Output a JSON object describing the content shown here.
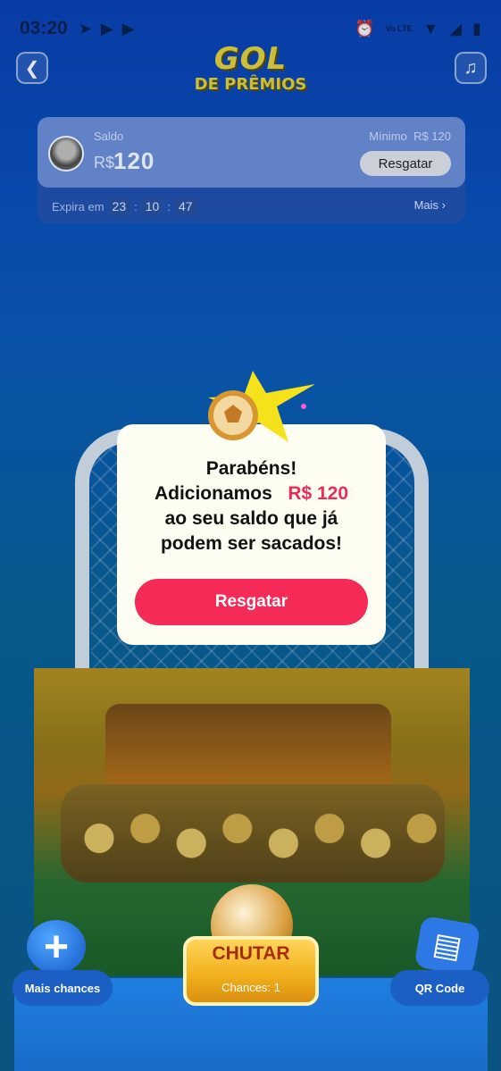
{
  "status_bar": {
    "time": "03:20",
    "notification_icons": [
      "telegram-icon",
      "youtube-icon",
      "youtube-icon"
    ],
    "right_icons": [
      "alarm-icon",
      "volte-icon",
      "wifi-icon",
      "signal-icon",
      "battery-icon"
    ],
    "volte_text": "Vo LTE"
  },
  "header": {
    "logo_line1": "GOL",
    "logo_line2": "DE PRÊMIOS"
  },
  "balance": {
    "label": "Saldo",
    "currency": "R$",
    "amount": "120",
    "minimum_label": "Mínimo",
    "minimum_value": "R$ 120",
    "redeem_label": "Resgatar",
    "expires_label": "Expira em",
    "hours": "23",
    "minutes": "10",
    "seconds": "47",
    "separator": ":",
    "more_label": "Mais",
    "more_chevron": "›"
  },
  "modal": {
    "line1": "Parabéns!",
    "line2_prefix": "Adicionamos",
    "amount": "R$ 120",
    "line3": "ao seu saldo que já",
    "line4": "podem ser sacados!",
    "button_label": "Resgatar"
  },
  "bottom": {
    "more_chances_label": "Mais chances",
    "kick_label": "CHUTAR",
    "chances_label": "Chances: 1",
    "qr_label": "QR Code"
  },
  "colors": {
    "accent": "#f52a57",
    "amount": "#ef2a56",
    "logo": "#e6d33a",
    "card": "#6f8fd6"
  }
}
